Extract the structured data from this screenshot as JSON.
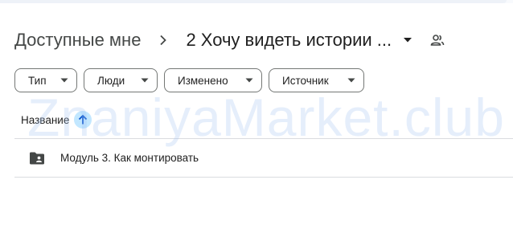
{
  "breadcrumb": {
    "root": "Доступные мне",
    "current": "2 Хочу видеть истории ..."
  },
  "filters": [
    {
      "label": "Тип"
    },
    {
      "label": "Люди"
    },
    {
      "label": "Изменено"
    },
    {
      "label": "Источник"
    }
  ],
  "table": {
    "column_name": "Название",
    "sort": "ascending",
    "rows": [
      {
        "name": "Модуль 3. Как монтировать",
        "icon": "shared-folder-icon"
      }
    ]
  },
  "watermark": "ZnaniyaMarket.club",
  "colors": {
    "sort_accent": "#c2e7ff",
    "chip_border": "#747775",
    "divider": "#dadce0"
  }
}
